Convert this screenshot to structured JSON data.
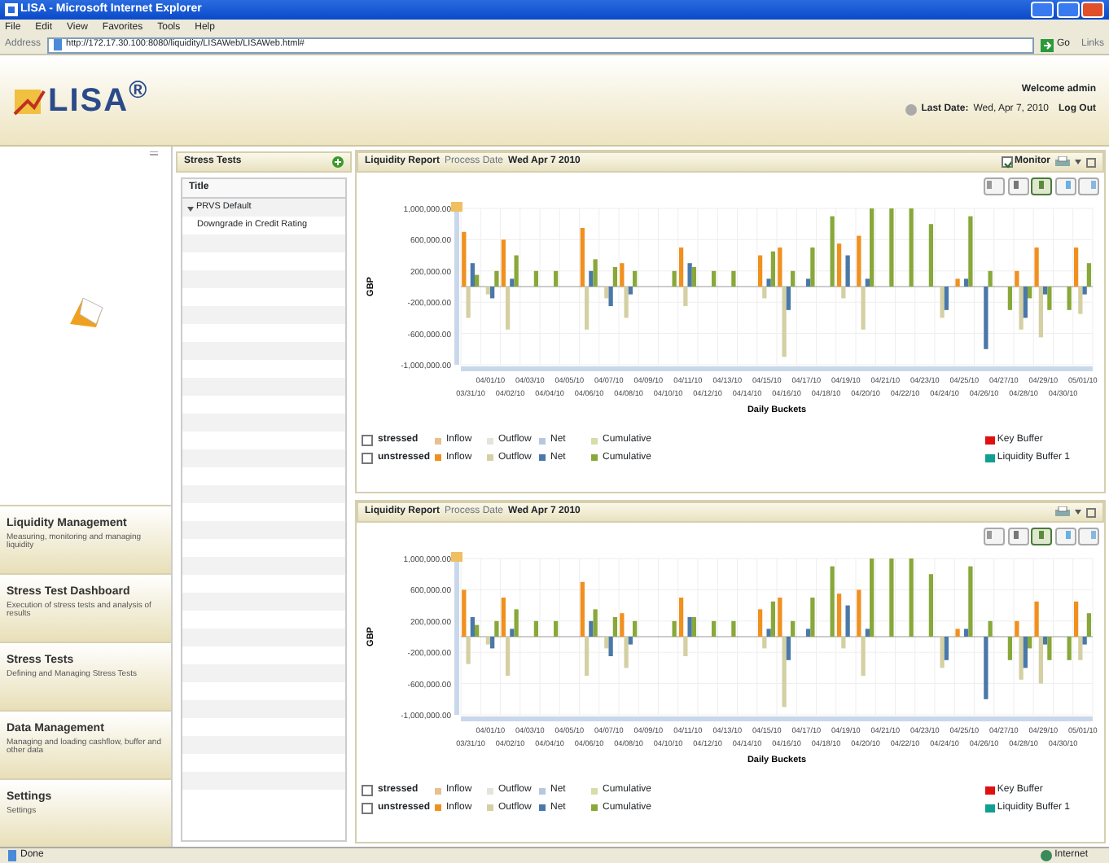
{
  "browser": {
    "title": "LISA - Microsoft Internet Explorer",
    "menu": [
      "File",
      "Edit",
      "View",
      "Favorites",
      "Tools",
      "Help"
    ],
    "address_label": "Address",
    "url": "http://172.17.30.100:8080/liquidity/LISAWeb/LISAWeb.html#",
    "go": "Go",
    "links": "Links"
  },
  "app": {
    "logo": "LISA$^{®}$",
    "welcome": "Welcome admin",
    "last_date_label": "Last Date:",
    "last_date": "Wed, Apr 7, 2010",
    "logout": "Log Out"
  },
  "nav": [
    {
      "title": "Liquidity Management",
      "subtitle": "Measuring, monitoring and managing liquidity"
    },
    {
      "title": "Stress Test Dashboard",
      "subtitle": "Execution of stress tests and analysis of results"
    },
    {
      "title": "Stress Tests",
      "subtitle": "Defining and Managing Stress Tests"
    },
    {
      "title": "Data Management",
      "subtitle": "Managing and loading cashflow, buffer and other data"
    },
    {
      "title": "Settings",
      "subtitle": "Settings"
    }
  ],
  "stress_tests": {
    "title": "Stress Tests",
    "column": "Title",
    "items": [
      {
        "label": "PRVS Default",
        "expanded": true,
        "children": [
          {
            "label": "Downgrade in Credit Rating"
          }
        ]
      }
    ]
  },
  "reports": [
    {
      "title": "Liquidity Report",
      "process_date_label": "Process Date",
      "process_date": "Wed Apr 7 2010",
      "monitor": {
        "label": "Monitor",
        "checked": true
      },
      "view_buttons": [
        {
          "selected": false
        },
        {
          "selected": false
        },
        {
          "selected": true
        },
        {
          "selected": false
        },
        {
          "selected": false
        }
      ],
      "chart_data": {
        "type": "bar",
        "xlabel": "Daily Buckets",
        "ylabel": "GBP",
        "categories": [
          "03/31/10",
          "04/01/10",
          "04/02/10",
          "04/03/10",
          "04/04/10",
          "04/05/10",
          "04/06/10",
          "04/07/10",
          "04/08/10",
          "04/09/10",
          "04/10/10",
          "04/11/10",
          "04/12/10",
          "04/13/10",
          "04/14/10",
          "04/15/10",
          "04/16/10",
          "04/17/10",
          "04/18/10",
          "04/19/10",
          "04/20/10",
          "04/21/10",
          "04/22/10",
          "04/23/10",
          "04/24/10",
          "04/25/10",
          "04/26/10",
          "04/27/10",
          "04/28/10",
          "04/29/10",
          "04/30/10",
          "05/01/10"
        ],
        "series": [
          {
            "name": "Inflow",
            "color": "#f0901e",
            "values": [
              700000,
              null,
              600000,
              null,
              null,
              null,
              750000,
              null,
              300000,
              null,
              null,
              500000,
              null,
              null,
              null,
              400000,
              500000,
              null,
              null,
              550000,
              650000,
              null,
              null,
              null,
              null,
              100000,
              null,
              null,
              200000,
              500000,
              null,
              500000
            ]
          },
          {
            "name": "Outflow",
            "color": "#d4d0a4",
            "values": [
              -400000,
              -100000,
              -550000,
              null,
              null,
              null,
              -550000,
              -150000,
              -400000,
              null,
              null,
              -250000,
              null,
              null,
              null,
              -150000,
              -900000,
              null,
              null,
              -150000,
              -550000,
              null,
              null,
              null,
              -400000,
              null,
              null,
              null,
              -550000,
              -650000,
              null,
              -350000
            ]
          },
          {
            "name": "Net",
            "color": "#4a78a8",
            "values": [
              300000,
              -150000,
              100000,
              null,
              null,
              null,
              200000,
              -250000,
              -100000,
              null,
              null,
              300000,
              null,
              null,
              null,
              100000,
              -300000,
              100000,
              null,
              400000,
              100000,
              null,
              null,
              null,
              -300000,
              100000,
              -800000,
              null,
              -400000,
              -100000,
              null,
              -100000
            ]
          },
          {
            "name": "Cumulative",
            "color": "#88a83a",
            "values": [
              150000,
              200000,
              400000,
              200000,
              200000,
              null,
              350000,
              250000,
              200000,
              null,
              200000,
              250000,
              200000,
              200000,
              null,
              450000,
              200000,
              500000,
              900000,
              null,
              1000000,
              1000000,
              1000000,
              800000,
              null,
              900000,
              200000,
              -300000,
              -150000,
              -300000,
              -300000,
              300000
            ]
          }
        ],
        "ylim": [
          -1000000,
          1000000
        ],
        "grid": true,
        "yticks": [
          {
            "value": 1000000,
            "label": "1,000,000.00"
          },
          {
            "value": 600000,
            "label": "600,000.00"
          },
          {
            "value": 200000,
            "label": "200,000.00"
          },
          {
            "value": -200000,
            "label": "-200,000.00"
          },
          {
            "value": -600000,
            "label": "-600,000.00"
          },
          {
            "value": -1000000,
            "label": "-1,000,000.00"
          }
        ]
      },
      "legend": {
        "rows": [
          {
            "label": "stressed",
            "checked": false,
            "items": [
              {
                "label": "Inflow",
                "color": "#e8c090"
              },
              {
                "label": "Outflow",
                "color": "#e4e4dc"
              },
              {
                "label": "Net",
                "color": "#b8c8dc"
              },
              {
                "label": "Cumulative",
                "color": "#d8dca8"
              }
            ]
          },
          {
            "label": "unstressed",
            "checked": false
          }
        ],
        "buffers": [
          {
            "label": "Key Buffer",
            "color": "#e01010"
          },
          {
            "label": "Liquidity Buffer 1",
            "color": "#10a090"
          }
        ]
      }
    },
    {
      "title": "Liquidity Report",
      "process_date_label": "Process Date",
      "process_date": "Wed Apr 7 2010",
      "view_buttons": [
        {
          "selected": false
        },
        {
          "selected": false
        },
        {
          "selected": true
        },
        {
          "selected": false
        },
        {
          "selected": false
        }
      ],
      "chart_data": {
        "type": "bar",
        "xlabel": "Daily Buckets",
        "ylabel": "GBP",
        "categories": [
          "03/31/10",
          "04/01/10",
          "04/02/10",
          "04/03/10",
          "04/04/10",
          "04/05/10",
          "04/06/10",
          "04/07/10",
          "04/08/10",
          "04/09/10",
          "04/10/10",
          "04/11/10",
          "04/12/10",
          "04/13/10",
          "04/14/10",
          "04/15/10",
          "04/16/10",
          "04/17/10",
          "04/18/10",
          "04/19/10",
          "04/20/10",
          "04/21/10",
          "04/22/10",
          "04/23/10",
          "04/24/10",
          "04/25/10",
          "04/26/10",
          "04/27/10",
          "04/28/10",
          "04/29/10",
          "04/30/10",
          "05/01/10"
        ],
        "series": [
          {
            "name": "Inflow",
            "color": "#f0901e",
            "values": [
              600000,
              null,
              500000,
              null,
              null,
              null,
              700000,
              null,
              300000,
              null,
              null,
              500000,
              null,
              null,
              null,
              350000,
              500000,
              null,
              null,
              550000,
              600000,
              null,
              null,
              null,
              null,
              100000,
              null,
              null,
              200000,
              450000,
              null,
              450000
            ]
          },
          {
            "name": "Outflow",
            "color": "#d4d0a4",
            "values": [
              -350000,
              -100000,
              -500000,
              null,
              null,
              null,
              -500000,
              -150000,
              -400000,
              null,
              null,
              -250000,
              null,
              null,
              null,
              -150000,
              -900000,
              null,
              null,
              -150000,
              -500000,
              null,
              null,
              null,
              -400000,
              null,
              null,
              null,
              -550000,
              -600000,
              null,
              -300000
            ]
          },
          {
            "name": "Net",
            "color": "#4a78a8",
            "values": [
              250000,
              -150000,
              100000,
              null,
              null,
              null,
              200000,
              -250000,
              -100000,
              null,
              null,
              250000,
              null,
              null,
              null,
              100000,
              -300000,
              100000,
              null,
              400000,
              100000,
              null,
              null,
              null,
              -300000,
              100000,
              -800000,
              null,
              -400000,
              -100000,
              null,
              -100000
            ]
          },
          {
            "name": "Cumulative",
            "color": "#88a83a",
            "values": [
              150000,
              200000,
              350000,
              200000,
              200000,
              null,
              350000,
              250000,
              200000,
              null,
              200000,
              250000,
              200000,
              200000,
              null,
              450000,
              200000,
              500000,
              900000,
              null,
              1000000,
              1000000,
              1000000,
              800000,
              null,
              900000,
              200000,
              -300000,
              -150000,
              -300000,
              -300000,
              300000
            ]
          }
        ],
        "ylim": [
          -1000000,
          1000000
        ],
        "grid": true,
        "yticks": [
          {
            "value": 1000000,
            "label": "1,000,000.00"
          },
          {
            "value": 600000,
            "label": "600,000.00"
          },
          {
            "value": 200000,
            "label": "200,000.00"
          },
          {
            "value": -200000,
            "label": "-200,000.00"
          },
          {
            "value": -600000,
            "label": "-600,000.00"
          },
          {
            "value": -1000000,
            "label": "-1,000,000.00"
          }
        ]
      },
      "legend": {
        "rows": [
          {
            "label": "stressed",
            "checked": false,
            "items": [
              {
                "label": "Inflow",
                "color": "#e8c090"
              },
              {
                "label": "Outflow",
                "color": "#e4e4dc"
              },
              {
                "label": "Net",
                "color": "#b8c8dc"
              },
              {
                "label": "Cumulative",
                "color": "#d8dca8"
              }
            ]
          },
          {
            "label": "unstressed",
            "checked": false
          }
        ],
        "buffers": [
          {
            "label": "Key Buffer",
            "color": "#e01010"
          },
          {
            "label": "Liquidity Buffer 1",
            "color": "#10a090"
          }
        ]
      }
    }
  ],
  "status_bar": {
    "text": "Done",
    "zone": "Internet"
  }
}
